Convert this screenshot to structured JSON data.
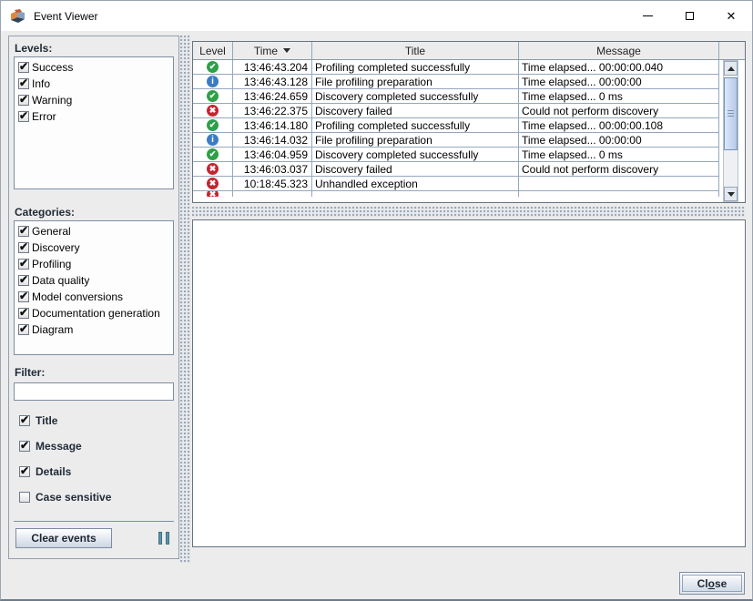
{
  "window": {
    "title": "Event Viewer",
    "icons": {
      "app": "app-logo-icon",
      "minimize": "minimize-icon",
      "maximize": "maximize-icon",
      "close": "close-icon"
    }
  },
  "sidebar": {
    "levels": {
      "label": "Levels:",
      "items": [
        {
          "label": "Success",
          "checked": true
        },
        {
          "label": "Info",
          "checked": true
        },
        {
          "label": "Warning",
          "checked": true
        },
        {
          "label": "Error",
          "checked": true
        }
      ]
    },
    "categories": {
      "label": "Categories:",
      "items": [
        {
          "label": "General",
          "checked": true
        },
        {
          "label": "Discovery",
          "checked": true
        },
        {
          "label": "Profiling",
          "checked": true
        },
        {
          "label": "Data quality",
          "checked": true
        },
        {
          "label": "Model conversions",
          "checked": true
        },
        {
          "label": "Documentation generation",
          "checked": true
        },
        {
          "label": "Diagram",
          "checked": true
        }
      ]
    },
    "filter": {
      "label": "Filter:",
      "value": "",
      "options": [
        {
          "label": "Title",
          "checked": true
        },
        {
          "label": "Message",
          "checked": true
        },
        {
          "label": "Details",
          "checked": true
        },
        {
          "label": "Case sensitive",
          "checked": false
        }
      ]
    },
    "clear_button": "Clear events",
    "pause_icon": "pause-icon"
  },
  "table": {
    "columns": [
      "Level",
      "Time",
      "Title",
      "Message"
    ],
    "sort": {
      "column": "Time",
      "direction": "desc",
      "icon": "sort-desc-icon"
    },
    "rows": [
      {
        "level": "success",
        "time": "13:46:43.204",
        "title": "Profiling completed successfully",
        "message": "Time elapsed... 00:00:00.040"
      },
      {
        "level": "info",
        "time": "13:46:43.128",
        "title": "File profiling preparation",
        "message": "Time elapsed... 00:00:00"
      },
      {
        "level": "success",
        "time": "13:46:24.659",
        "title": "Discovery completed successfully",
        "message": "Time elapsed... 0 ms"
      },
      {
        "level": "error",
        "time": "13:46:22.375",
        "title": "Discovery failed",
        "message": "Could not perform discovery"
      },
      {
        "level": "success",
        "time": "13:46:14.180",
        "title": "Profiling completed successfully",
        "message": "Time elapsed... 00:00:00.108"
      },
      {
        "level": "info",
        "time": "13:46:14.032",
        "title": "File profiling preparation",
        "message": "Time elapsed... 00:00:00"
      },
      {
        "level": "success",
        "time": "13:46:04.959",
        "title": "Discovery completed successfully",
        "message": "Time elapsed... 0 ms"
      },
      {
        "level": "error",
        "time": "13:46:03.037",
        "title": "Discovery failed",
        "message": "Could not perform discovery"
      },
      {
        "level": "error",
        "time": "10:18:45.323",
        "title": "Unhandled exception",
        "message": ""
      }
    ],
    "partial_row": {
      "level": "error"
    },
    "level_icons": {
      "success": "success-icon",
      "info": "info-icon",
      "error": "error-icon"
    }
  },
  "footer": {
    "close_pre": "Cl",
    "close_mnemonic": "o",
    "close_post": "se"
  },
  "colors": {
    "success": "#2da048",
    "info": "#3b7cc4",
    "error": "#c5252f",
    "grid_line": "#95a7bd",
    "panel_border": "#66737f",
    "pause_teal": "#5b93a8",
    "button_face": "#ccd6e4",
    "sidebar_bg": "#ececec"
  }
}
